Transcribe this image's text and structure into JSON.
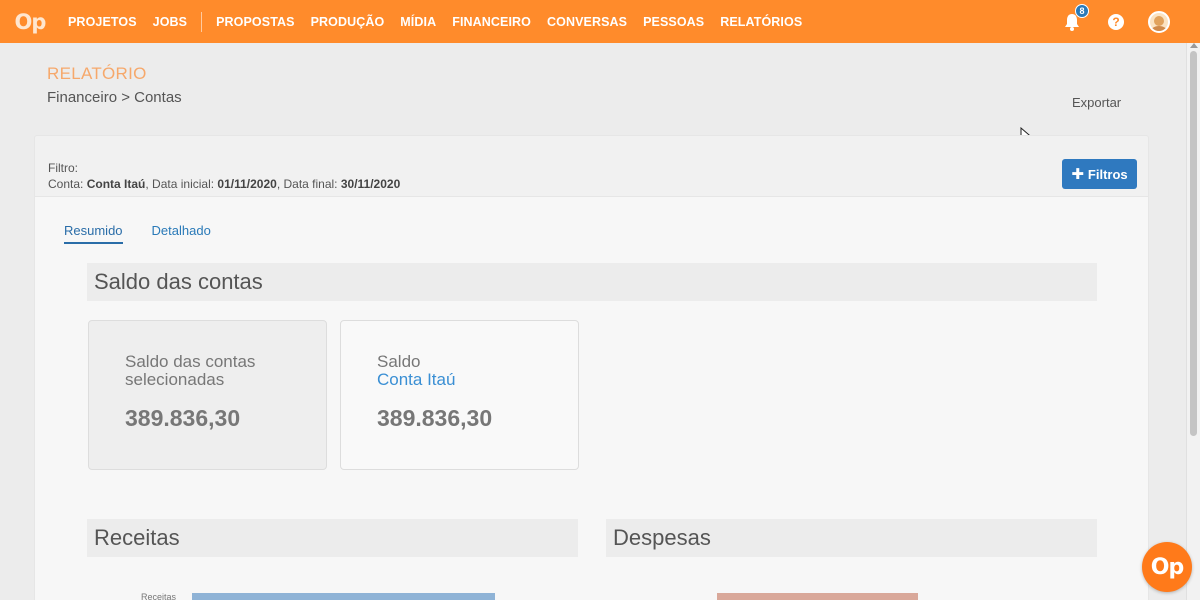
{
  "topbar": {
    "logo": "Op",
    "nav": [
      "PROJETOS",
      "JOBS",
      "PROPOSTAS",
      "PRODUÇÃO",
      "MÍDIA",
      "FINANCEIRO",
      "CONVERSAS",
      "PESSOAS",
      "RELATÓRIOS"
    ],
    "notifications_count": "8",
    "help": "?",
    "brand_color": "#ff8b2b"
  },
  "header": {
    "title": "RELATÓRIO",
    "breadcrumb": "Financeiro > Contas",
    "export_label": "Exportar"
  },
  "filter": {
    "label": "Filtro:",
    "conta_label": "Conta: ",
    "conta_value": "Conta Itaú",
    "data_inicial_label": ", Data inicial: ",
    "data_inicial_value": "01/11/2020",
    "data_final_label": ", Data final: ",
    "data_final_value": "30/11/2020",
    "button_label": "Filtros"
  },
  "tabs": [
    {
      "label": "Resumido",
      "active": true
    },
    {
      "label": "Detalhado",
      "active": false
    }
  ],
  "saldo": {
    "heading": "Saldo das contas",
    "cards": [
      {
        "label_line1": "Saldo das contas",
        "label_line2": "selecionadas",
        "value": "389.836,30"
      },
      {
        "label_line1": "Saldo",
        "label_line2": "Conta Itaú",
        "value": "389.836,30"
      }
    ]
  },
  "receitas": {
    "heading": "Receitas",
    "bar_label": "Receitas",
    "bar_color": "#8fb3d6"
  },
  "despesas": {
    "heading": "Despesas",
    "bar_color": "#d9a89a"
  },
  "fab_label": "Op"
}
